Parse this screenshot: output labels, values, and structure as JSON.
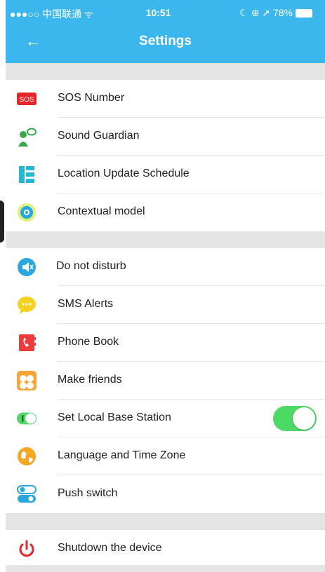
{
  "status_bar": {
    "carrier": "●●●○○ 中国联通 ᯤ",
    "time": "10:51",
    "right": "☾ ⊕ ➚ 78%"
  },
  "header": {
    "back_icon": "←",
    "title": "Settings"
  },
  "section1": [
    {
      "icon": "sos-icon",
      "label": "SOS Number"
    },
    {
      "icon": "sound-guardian-icon",
      "label": "Sound Guardian"
    },
    {
      "icon": "location-schedule-icon",
      "label": "Location Update Schedule"
    },
    {
      "icon": "contextual-model-icon",
      "label": "Contextual model"
    }
  ],
  "section2": [
    {
      "icon": "do-not-disturb-icon",
      "label": "Do not disturb"
    },
    {
      "icon": "sms-alerts-icon",
      "label": "SMS Alerts"
    },
    {
      "icon": "phone-book-icon",
      "label": "Phone Book"
    },
    {
      "icon": "make-friends-icon",
      "label": "Make friends"
    },
    {
      "icon": "base-station-icon",
      "label": "Set Local Base Station",
      "toggle": "on"
    },
    {
      "icon": "language-timezone-icon",
      "label": "Language and Time Zone"
    },
    {
      "icon": "push-switch-icon",
      "label": "Push switch"
    }
  ],
  "section3": [
    {
      "icon": "power-icon",
      "label": "Shutdown the device"
    }
  ],
  "colors": {
    "header": "#3bb7ee",
    "toggle_on": "#4cd964",
    "section_gap": "#e5e5e5"
  }
}
